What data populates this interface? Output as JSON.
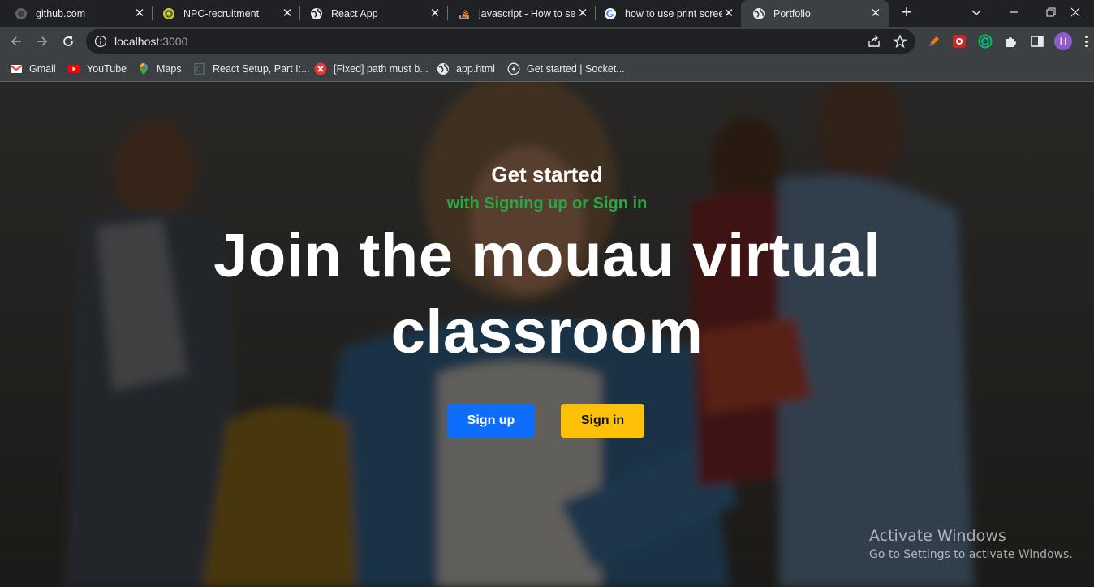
{
  "browser": {
    "tabs": [
      {
        "title": "github.com",
        "icon": "github-icon",
        "active": false
      },
      {
        "title": "NPC-recruitment",
        "icon": "npc-logo-icon",
        "active": false
      },
      {
        "title": "React App",
        "icon": "globe-icon",
        "active": false
      },
      {
        "title": "javascript - How to se",
        "icon": "stackoverflow-icon",
        "active": false
      },
      {
        "title": "how to use print scree",
        "icon": "google-icon",
        "active": false
      },
      {
        "title": "Portfolio",
        "icon": "globe-icon",
        "active": true
      }
    ],
    "new_tab_label": "+",
    "url": {
      "host": "localhost",
      "port": ":3000"
    },
    "profile_initial": "H",
    "bookmarks": [
      {
        "label": "Gmail",
        "icon": "gmail-icon"
      },
      {
        "label": "YouTube",
        "icon": "youtube-icon"
      },
      {
        "label": "Maps",
        "icon": "maps-icon"
      },
      {
        "label": "React Setup, Part I:...",
        "icon": "doc-icon"
      },
      {
        "label": "[Fixed] path must b...",
        "icon": "error-icon"
      },
      {
        "label": "app.html",
        "icon": "globe-icon"
      },
      {
        "label": "Get started | Socket...",
        "icon": "socketio-icon"
      }
    ]
  },
  "hero": {
    "eyebrow": "Get started",
    "subtitle": "with Signing up or Sign in",
    "title": "Join the mouau virtual classroom",
    "signup_label": "Sign up",
    "signin_label": "Sign in"
  },
  "watermark": {
    "title": "Activate Windows",
    "subtitle": "Go to Settings to activate Windows."
  },
  "colors": {
    "accent_green": "#28a745",
    "signup_blue": "#0d6efd",
    "signin_yellow": "#ffc107"
  }
}
